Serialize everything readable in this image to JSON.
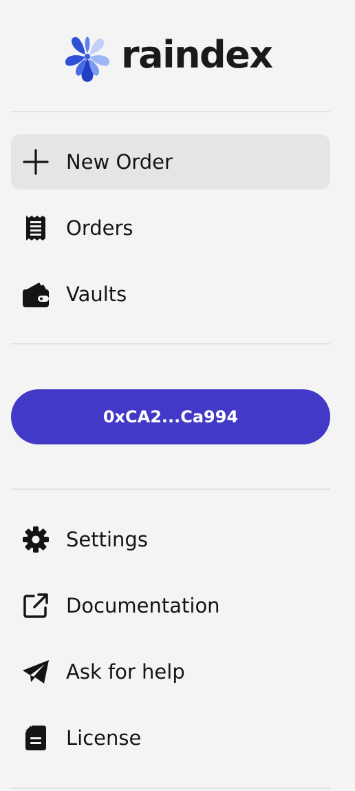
{
  "brand": {
    "name": "raindex",
    "colors": {
      "petal_dark": "#2e4fd6",
      "petal_mid": "#5f80ee",
      "petal_light": "#9fb6f6",
      "petal_pale": "#c3d1fa"
    }
  },
  "nav_primary": [
    {
      "label": "New Order",
      "icon": "plus-icon",
      "active": true
    },
    {
      "label": "Orders",
      "icon": "receipt-icon",
      "active": false
    },
    {
      "label": "Vaults",
      "icon": "wallet-icon",
      "active": false
    }
  ],
  "wallet": {
    "label": "0xCA2...Ca994",
    "color": "#4239c6"
  },
  "nav_secondary": [
    {
      "label": "Settings",
      "icon": "gear-icon"
    },
    {
      "label": "Documentation",
      "icon": "external-link-icon"
    },
    {
      "label": "Ask for help",
      "icon": "telegram-icon"
    },
    {
      "label": "License",
      "icon": "document-icon"
    }
  ]
}
